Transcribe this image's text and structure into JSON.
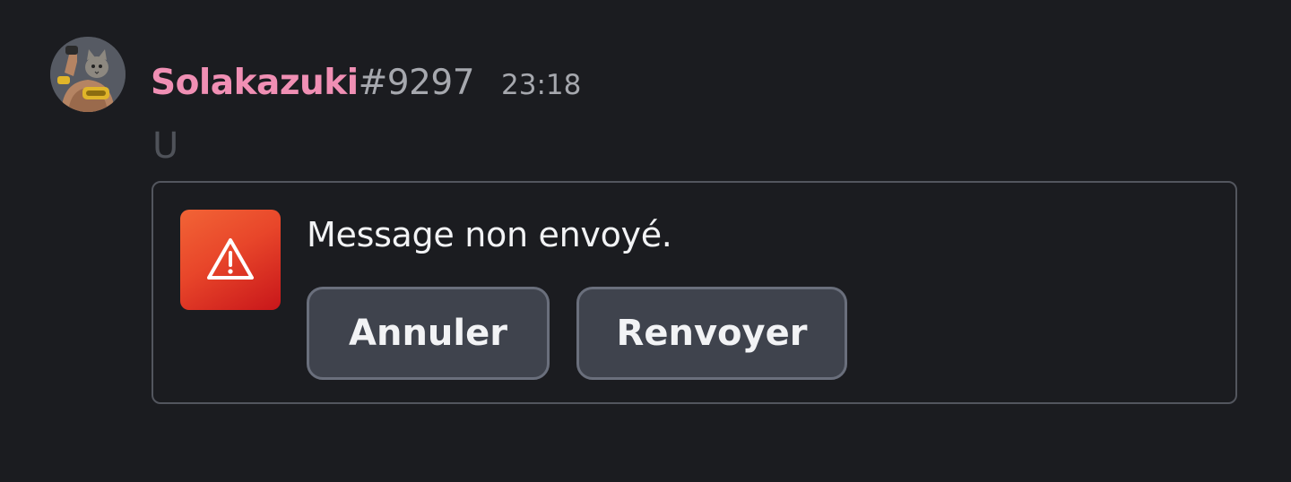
{
  "message": {
    "author": {
      "username": "Solakazuki",
      "discriminator": "#9297",
      "avatar_icon": "user-avatar-icon",
      "name_color": "#f08fb4"
    },
    "timestamp": "23:18",
    "content": "U"
  },
  "send_error": {
    "icon": "warning-triangle-icon",
    "badge_color": "#e8462a",
    "title": "Message non envoyé.",
    "cancel_label": "Annuler",
    "resend_label": "Renvoyer"
  }
}
